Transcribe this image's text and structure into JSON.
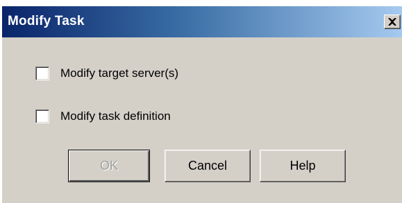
{
  "dialog": {
    "title": "Modify Task",
    "close_label": "×"
  },
  "options": [
    {
      "label": "Modify target server(s)",
      "checked": false
    },
    {
      "label": "Modify task definition",
      "checked": false
    }
  ],
  "buttons": {
    "ok": "OK",
    "cancel": "Cancel",
    "help": "Help"
  },
  "colors": {
    "titlebar_start": "#0a246a",
    "titlebar_end": "#a6caf0",
    "face": "#d4d0c8",
    "disabled_text": "#a0a0a0"
  }
}
